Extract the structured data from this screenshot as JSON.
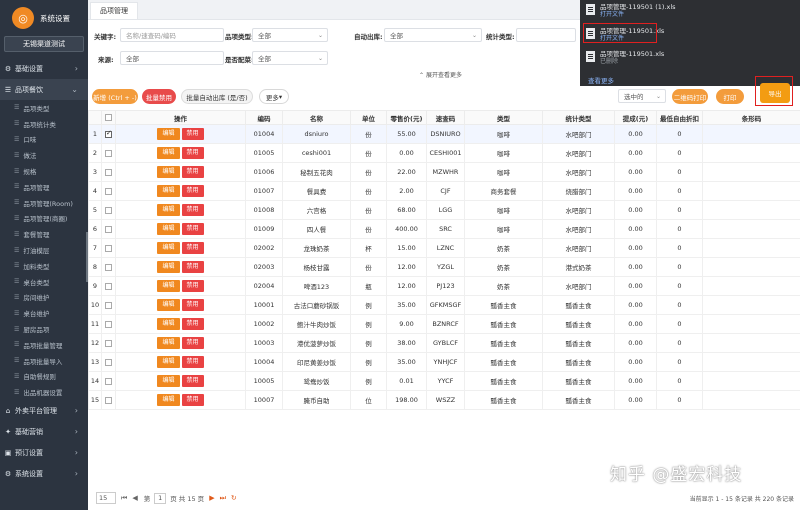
{
  "sidebar": {
    "logo_text": "系统设置",
    "store_button": "无锡渠道测试",
    "groups_top": [
      {
        "label": "基础设置",
        "icon": "gear-icon"
      },
      {
        "label": "品项餐饮",
        "icon": "menu-icon"
      }
    ],
    "sub_items": [
      "品项类型",
      "品项统计类",
      "口味",
      "做法",
      "规格",
      "品项管理",
      "品项管理(Room)",
      "品项管理(商圈)",
      "套餐管理",
      "打油模层",
      "加料类型",
      "桌台类型",
      "房间维护",
      "桌台维护",
      "厨房品项",
      "品项批量管理",
      "品项批量导入",
      "自助餐规则",
      "出品机器设置"
    ],
    "groups_bottom": [
      {
        "label": "外卖平台管理",
        "icon": "delivery-icon"
      },
      {
        "label": "基础营销",
        "icon": "marketing-icon"
      },
      {
        "label": "预订设置",
        "icon": "booking-icon"
      },
      {
        "label": "系统设置",
        "icon": "system-icon"
      }
    ]
  },
  "tab": {
    "label": "品项管理"
  },
  "filters": {
    "keyword_label": "关键字:",
    "keyword_placeholder": "名称/速查码/编码",
    "type_label": "品项类型:",
    "type_value": "全部",
    "auto_out_label": "自动出库:",
    "auto_out_value": "全部",
    "stat_label": "统计类型:",
    "source_label": "来源:",
    "source_value": "全部",
    "config_label": "是否配菜:",
    "config_value": "全部",
    "expand_label": "展开查看更多"
  },
  "toolbar": {
    "new_label": "新增 (Ctrl + -)",
    "batch_disable_label": "批量禁用",
    "batch_auto_label": "批量自动出库 (是/否)",
    "more_label": "更多",
    "select_value": "选中的",
    "qrcode_label": "二维码打印",
    "print_label": "打印",
    "export_label": "导出"
  },
  "table": {
    "headers": [
      "操作",
      "编码",
      "名称",
      "单位",
      "零售价(元)",
      "速查码",
      "类型",
      "统计类型",
      "提成(元)",
      "最低自由折扣",
      "条形码"
    ],
    "edit_label": "编辑",
    "disable_label": "禁用",
    "rows": [
      {
        "no": "1",
        "code": "01004",
        "name": "dsniuro",
        "unit": "份",
        "price": "55.00",
        "quick": "DSNIURO",
        "type": "咖啡",
        "stat": "水吧部门",
        "commission": "0.00",
        "discount": "0",
        "checked": true
      },
      {
        "no": "2",
        "code": "01005",
        "name": "ceshi001",
        "unit": "份",
        "price": "0.00",
        "quick": "CESHI001",
        "type": "咖啡",
        "stat": "水吧部门",
        "commission": "0.00",
        "discount": "0",
        "checked": false
      },
      {
        "no": "3",
        "code": "01006",
        "name": "秘制五花肉",
        "unit": "份",
        "price": "22.00",
        "quick": "MZWHR",
        "type": "咖啡",
        "stat": "水吧部门",
        "commission": "0.00",
        "discount": "0",
        "checked": false
      },
      {
        "no": "4",
        "code": "01007",
        "name": "餐具费",
        "unit": "份",
        "price": "2.00",
        "quick": "CJF",
        "type": "商务套餐",
        "stat": "烧腊部门",
        "commission": "0.00",
        "discount": "0",
        "checked": false
      },
      {
        "no": "5",
        "code": "01008",
        "name": "六宫格",
        "unit": "份",
        "price": "68.00",
        "quick": "LGG",
        "type": "咖啡",
        "stat": "水吧部门",
        "commission": "0.00",
        "discount": "0",
        "checked": false
      },
      {
        "no": "6",
        "code": "01009",
        "name": "四人餐",
        "unit": "份",
        "price": "400.00",
        "quick": "SRC",
        "type": "咖啡",
        "stat": "水吧部门",
        "commission": "0.00",
        "discount": "0",
        "checked": false
      },
      {
        "no": "7",
        "code": "02002",
        "name": "龙珠奶茶",
        "unit": "杯",
        "price": "15.00",
        "quick": "LZNC",
        "type": "奶茶",
        "stat": "水吧部门",
        "commission": "0.00",
        "discount": "0",
        "checked": false
      },
      {
        "no": "8",
        "code": "02003",
        "name": "杨枝甘露",
        "unit": "份",
        "price": "12.00",
        "quick": "YZGL",
        "type": "奶茶",
        "stat": "港式奶茶",
        "commission": "0.00",
        "discount": "0",
        "checked": false
      },
      {
        "no": "9",
        "code": "02004",
        "name": "啤酒123",
        "unit": "瓶",
        "price": "12.00",
        "quick": "PJ123",
        "type": "奶茶",
        "stat": "水吧部门",
        "commission": "0.00",
        "discount": "0",
        "checked": false
      },
      {
        "no": "10",
        "code": "10001",
        "name": "古法口蘑砂锅饭",
        "unit": "例",
        "price": "35.00",
        "quick": "GFKMSGF",
        "type": "瓢香主食",
        "stat": "瓢香主食",
        "commission": "0.00",
        "discount": "0",
        "checked": false
      },
      {
        "no": "11",
        "code": "10002",
        "name": "鲍汁牛肉炒饭",
        "unit": "例",
        "price": "9.00",
        "quick": "BZNRCF",
        "type": "瓢香主食",
        "stat": "瓢香主食",
        "commission": "0.00",
        "discount": "0",
        "checked": false
      },
      {
        "no": "12",
        "code": "10003",
        "name": "港优菠萝炒饭",
        "unit": "例",
        "price": "38.00",
        "quick": "GYBLCF",
        "type": "瓢香主食",
        "stat": "瓢香主食",
        "commission": "0.00",
        "discount": "0",
        "checked": false
      },
      {
        "no": "13",
        "code": "10004",
        "name": "印尼黄姜炒饭",
        "unit": "例",
        "price": "35.00",
        "quick": "YNHJCF",
        "type": "瓢香主食",
        "stat": "瓢香主食",
        "commission": "0.00",
        "discount": "0",
        "checked": false
      },
      {
        "no": "14",
        "code": "10005",
        "name": "鸳鸯炒饭",
        "unit": "例",
        "price": "0.01",
        "quick": "YYCF",
        "type": "瓢香主食",
        "stat": "瓢香主食",
        "commission": "0.00",
        "discount": "0",
        "checked": false
      },
      {
        "no": "15",
        "code": "10007",
        "name": "腌币自助",
        "unit": "位",
        "price": "198.00",
        "quick": "WSZZ",
        "type": "瓢香主食",
        "stat": "瓢香主食",
        "commission": "0.00",
        "discount": "0",
        "checked": false
      }
    ]
  },
  "pager": {
    "page_size": "15",
    "page_prefix": "第",
    "page_current": "1",
    "page_suffix": "页 共 15 页",
    "summary": "当前显示 1 - 15 条记录 共 220 条记录"
  },
  "downloads": {
    "items": [
      {
        "name": "品项管理-119501 (1).xls",
        "sub": "打开文件",
        "sub_grey": false
      },
      {
        "name": "品项管理-119501.xls",
        "sub": "打开文件",
        "sub_grey": false
      },
      {
        "name": "品项管理-119501.xls",
        "sub": "已删除",
        "sub_grey": true
      }
    ],
    "more_label": "查看更多"
  },
  "watermark": "知乎 @盛宏科技"
}
